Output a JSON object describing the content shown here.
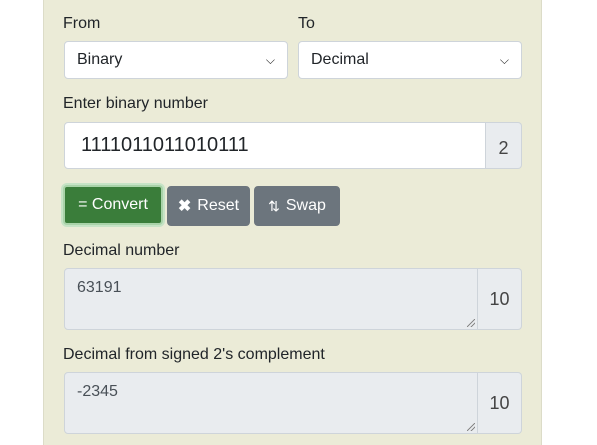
{
  "from": {
    "label": "From",
    "selected": "Binary"
  },
  "to": {
    "label": "To",
    "selected": "Decimal"
  },
  "input": {
    "label": "Enter binary number",
    "value": "1111011011010111",
    "base": "2"
  },
  "buttons": {
    "convert": "= Convert",
    "reset": "Reset",
    "swap": "Swap"
  },
  "icons": {
    "reset": "close-icon",
    "swap": "swap-icon"
  },
  "decimal": {
    "label": "Decimal number",
    "value": "63191",
    "base": "10"
  },
  "signed": {
    "label": "Decimal from signed 2's complement",
    "value": "-2345",
    "base": "10"
  },
  "colors": {
    "convert_button": "#3a7d3a",
    "gray_button": "#6c757d",
    "panel": "#ebebd7"
  }
}
